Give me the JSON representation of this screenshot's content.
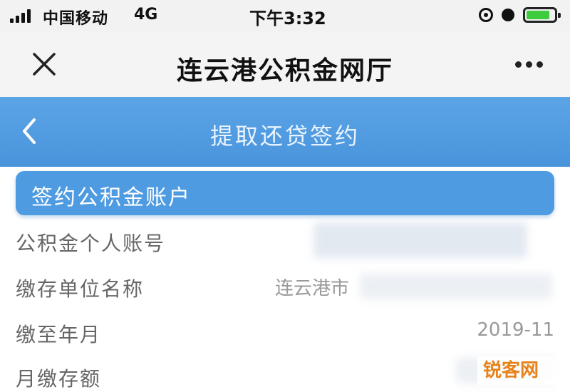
{
  "status_bar": {
    "carrier": "中国移动",
    "network": "4G",
    "time": "下午3:32",
    "battery_color": "#3ecb3e",
    "battery_level": 0.85
  },
  "app_header": {
    "title": "连云港公积金网厅",
    "close_icon": "close-icon",
    "more_icon": "more-icon"
  },
  "page_bar": {
    "title": "提取还贷签约",
    "back_icon": "chevron-left-icon",
    "color": "#4f9be2"
  },
  "section": {
    "title": "签约公积金账户"
  },
  "rows": [
    {
      "label": "公积金个人账号",
      "value": ""
    },
    {
      "label": "缴存单位名称",
      "value": "连云港市"
    },
    {
      "label": "缴至年月",
      "value": "2019-11"
    },
    {
      "label": "月缴存额",
      "value": ""
    }
  ],
  "watermark": {
    "text": "锐客网",
    "color": "#e8821a"
  }
}
